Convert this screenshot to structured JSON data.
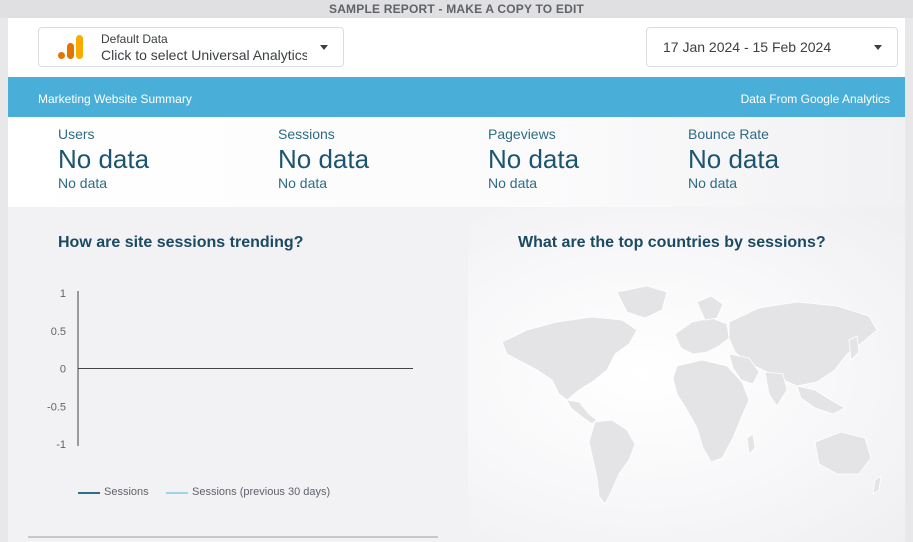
{
  "banner": {
    "text": "SAMPLE REPORT - MAKE A COPY TO EDIT"
  },
  "data_source": {
    "title": "Default Data",
    "value": "Click to select Universal Analytics"
  },
  "date_range": {
    "value": "17 Jan 2024 - 15 Feb 2024"
  },
  "header": {
    "left": "Marketing Website Summary",
    "right": "Data From Google Analytics"
  },
  "kpis": [
    {
      "label": "Users",
      "value": "No data",
      "sub": "No data"
    },
    {
      "label": "Sessions",
      "value": "No data",
      "sub": "No data"
    },
    {
      "label": "Pageviews",
      "value": "No data",
      "sub": "No data"
    },
    {
      "label": "Bounce Rate",
      "value": "No data",
      "sub": "No data"
    }
  ],
  "left_panel": {
    "title": "How are site sessions trending?"
  },
  "right_panel": {
    "title": "What are the top countries by sessions?"
  },
  "colors": {
    "accent": "#4aafd8",
    "series_current": "#2f6f87",
    "series_previous": "#9fd3ea"
  },
  "icons": {
    "data_source_logo": "google-analytics-logo-icon",
    "dropdown": "caret-down-icon"
  },
  "chart_data": {
    "type": "line",
    "title": "How are site sessions trending?",
    "xlabel": "",
    "ylabel": "",
    "ylim": [
      -1,
      1
    ],
    "y_ticks": [
      "1",
      "0.5",
      "0",
      "-0.5",
      "-1"
    ],
    "series": [
      {
        "name": "Sessions",
        "values": []
      },
      {
        "name": "Sessions (previous 30 days)",
        "values": []
      }
    ],
    "grid": false,
    "legend_position": "bottom"
  }
}
